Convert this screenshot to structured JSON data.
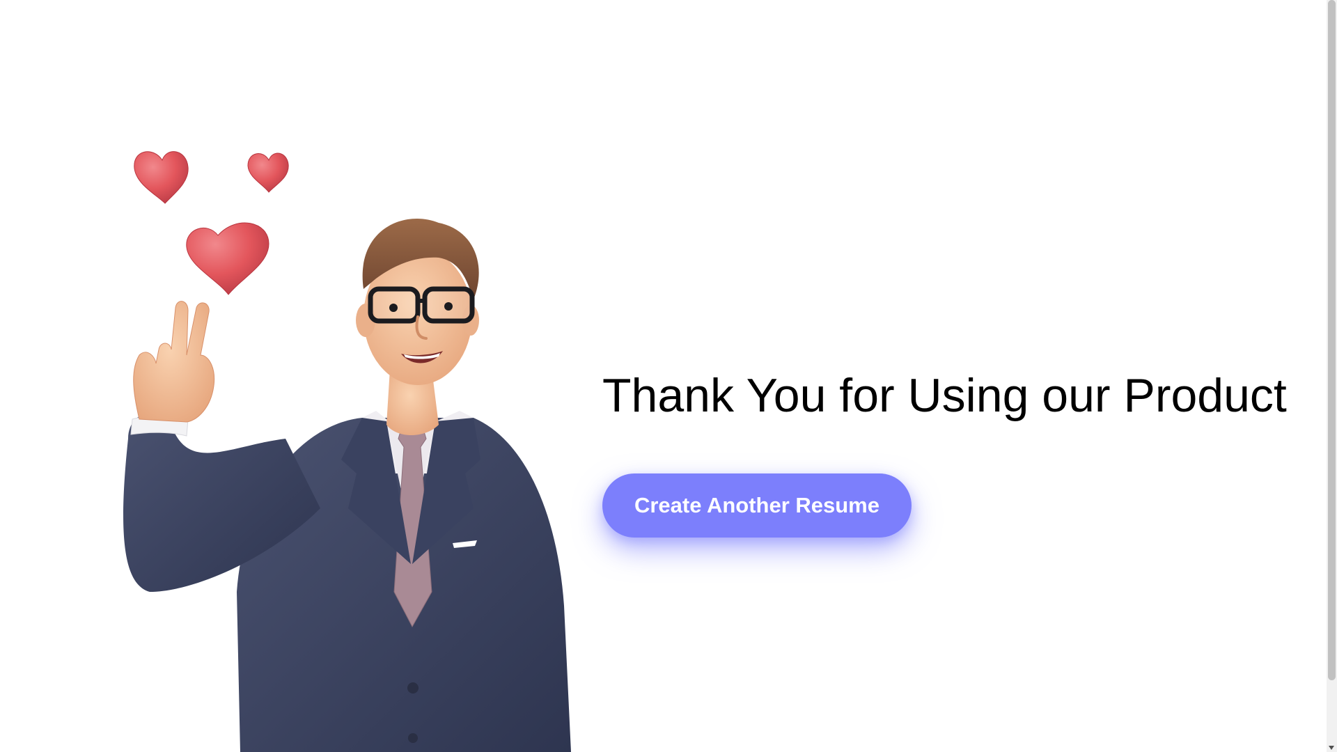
{
  "page": {
    "headline": "Thank You for Using our Product",
    "cta_label": "Create Another Resume"
  },
  "illustration": {
    "icon": "businessman-peace-sign-with-hearts",
    "heart_count": 3
  },
  "colors": {
    "accent": "#7c7ffc",
    "suit": "#3c4460",
    "heart": "#e3565c",
    "skin": "#f2c09a",
    "hair": "#8a5a3c",
    "tie": "#a98a95"
  },
  "scroll": {
    "position_fraction": 0.0,
    "thumb_fraction": 0.92
  }
}
